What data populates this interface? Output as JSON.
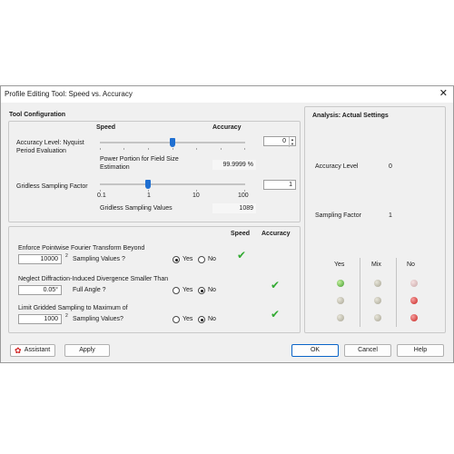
{
  "window": {
    "title": "Profile Editing Tool: Speed vs. Accuracy",
    "close_glyph": "✕"
  },
  "tool_config": {
    "title": "Tool Configuration",
    "speed_label": "Speed",
    "accuracy_label": "Accuracy",
    "nyquist_label_1": "Accuracy Level: Nyquist",
    "nyquist_label_2": "Period Evaluation",
    "accuracy_value": "0",
    "accuracy_slider_fraction": 0.5,
    "power_label_1": "Power Portion for Field Size",
    "power_label_2": "Estimation",
    "power_value": "99.9999 %",
    "gridless_label": "Gridless Sampling Factor",
    "gridless_value": "1",
    "gridless_slider_fraction": 0.33,
    "ticks": [
      "0.1",
      "1",
      "10",
      "100"
    ],
    "gridless_values_label": "Gridless Sampling Values",
    "gridless_values_value": "1089"
  },
  "options": {
    "speed_header": "Speed",
    "accuracy_header": "Accuracy",
    "yes": "Yes",
    "no": "No",
    "fourier": {
      "label": "Enforce Pointwise Fourier Transform Beyond",
      "value": "10000",
      "exp": "2",
      "suffix": "Sampling Values ?",
      "selected": "Yes"
    },
    "divergence": {
      "label": "Neglect Diffraction-Induced Divergence Smaller Than",
      "value": "0.05°",
      "suffix": "Full Angle ?",
      "selected": "No"
    },
    "gridded": {
      "label": "Limit Gridded Sampling to Maximum of",
      "value": "1000",
      "exp": "2",
      "suffix": "Sampling Values?",
      "selected": "No"
    },
    "check_glyph": "✔"
  },
  "analysis": {
    "title": "Analysis: Actual Settings",
    "accuracy_level_label": "Accuracy Level",
    "accuracy_level_value": "0",
    "sampling_factor_label": "Sampling Factor",
    "sampling_factor_value": "1",
    "cols": [
      "Yes",
      "Mix",
      "No"
    ],
    "rows": [
      [
        "green",
        "gray",
        "pink"
      ],
      [
        "gray",
        "gray",
        "red"
      ],
      [
        "gray",
        "gray",
        "red"
      ]
    ],
    "colors": {
      "green": "#3d9a2a",
      "gray": "#a6a392",
      "red": "#c8221e"
    }
  },
  "buttons": {
    "assistant": "Assistant",
    "apply": "Apply",
    "ok": "OK",
    "cancel": "Cancel",
    "help": "Help"
  }
}
